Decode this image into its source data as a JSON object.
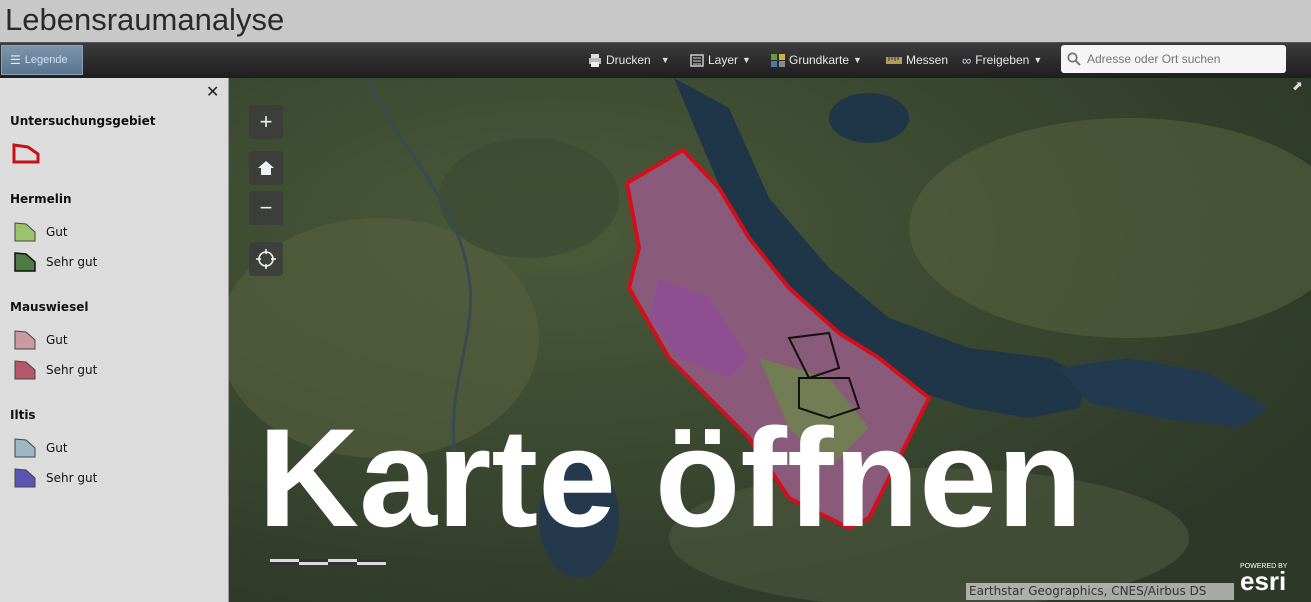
{
  "app": {
    "title": "Lebensraumanalyse"
  },
  "toolbar": {
    "legend_label": "Legende",
    "print_label": "Drucken",
    "layer_label": "Layer",
    "basemap_label": "Grundkarte",
    "measure_label": "Messen",
    "share_label": "Freigeben",
    "search_placeholder": "Adresse oder Ort suchen"
  },
  "sidebar": {
    "sections": [
      {
        "title": "Untersuchungsgebiet",
        "items": []
      },
      {
        "title": "Hermelin",
        "items": [
          {
            "label": "Gut",
            "color": "#9bc46a"
          },
          {
            "label": "Sehr gut",
            "color": "#4e7a44"
          }
        ]
      },
      {
        "title": "Mauswiesel",
        "items": [
          {
            "label": "Gut",
            "color": "#c99a9f"
          },
          {
            "label": "Sehr gut",
            "color": "#b4566c"
          }
        ]
      },
      {
        "title": "Iltis",
        "items": [
          {
            "label": "Gut",
            "color": "#9fb7c4"
          },
          {
            "label": "Sehr gut",
            "color": "#5a55b3"
          }
        ]
      }
    ],
    "area_color": "#c8101a"
  },
  "map": {
    "overlay_text": "Karte öffnen",
    "attribution": "Earthstar Geographics, CNES/Airbus DS",
    "esri_powered": "POWERED BY",
    "esri_logo": "esri"
  }
}
